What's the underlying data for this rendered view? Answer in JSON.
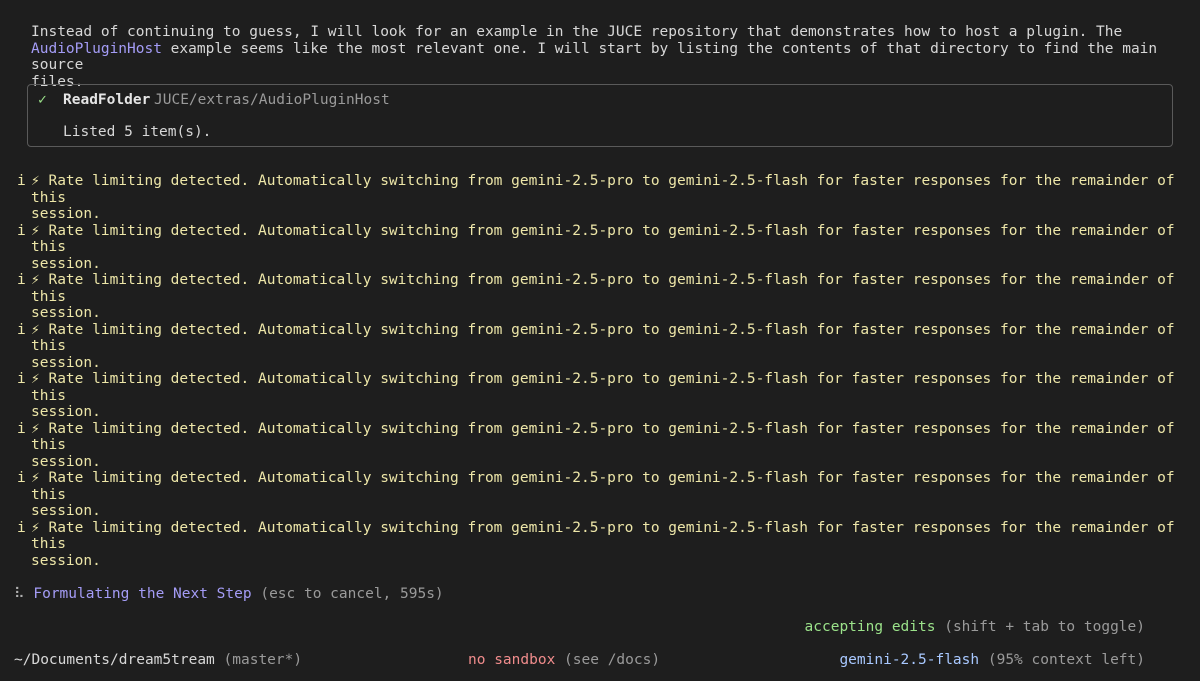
{
  "intro": {
    "line1": "Instead of continuing to guess, I will look for an example in the JUCE repository that demonstrates how to host a plugin. The",
    "link": "AudioPluginHost",
    "line2_rest": " example seems like the most relevant one. I will start by listing the contents of that directory to find the main source",
    "line3": "files."
  },
  "tool_call": {
    "status_icon": "✓",
    "name": "ReadFolder",
    "path": "JUCE/extras/AudioPluginHost",
    "result": "Listed 5 item(s)."
  },
  "notices": [
    {
      "prefix": "i",
      "icon": "⚡",
      "text": "Rate limiting detected. Automatically switching from gemini-2.5-pro to gemini-2.5-flash for faster responses for the remainder of this",
      "cont": "session."
    },
    {
      "prefix": "i",
      "icon": "⚡",
      "text": "Rate limiting detected. Automatically switching from gemini-2.5-pro to gemini-2.5-flash for faster responses for the remainder of this",
      "cont": "session."
    },
    {
      "prefix": "i",
      "icon": "⚡",
      "text": "Rate limiting detected. Automatically switching from gemini-2.5-pro to gemini-2.5-flash for faster responses for the remainder of this",
      "cont": "session."
    },
    {
      "prefix": "i",
      "icon": "⚡",
      "text": "Rate limiting detected. Automatically switching from gemini-2.5-pro to gemini-2.5-flash for faster responses for the remainder of this",
      "cont": "session."
    },
    {
      "prefix": "i",
      "icon": "⚡",
      "text": "Rate limiting detected. Automatically switching from gemini-2.5-pro to gemini-2.5-flash for faster responses for the remainder of this",
      "cont": "session."
    },
    {
      "prefix": "i",
      "icon": "⚡",
      "text": "Rate limiting detected. Automatically switching from gemini-2.5-pro to gemini-2.5-flash for faster responses for the remainder of this",
      "cont": "session."
    },
    {
      "prefix": "i",
      "icon": "⚡",
      "text": "Rate limiting detected. Automatically switching from gemini-2.5-pro to gemini-2.5-flash for faster responses for the remainder of this",
      "cont": "session."
    },
    {
      "prefix": "i",
      "icon": "⚡",
      "text": "Rate limiting detected. Automatically switching from gemini-2.5-pro to gemini-2.5-flash for faster responses for the remainder of this",
      "cont": "session."
    }
  ],
  "status": {
    "spinner": "⠧",
    "text": "Formulating the Next Step",
    "hint": " (esc to cancel, 595s)"
  },
  "mode": {
    "text": "accepting edits",
    "hint": " (shift + tab to toggle)"
  },
  "footer": {
    "path": "~/Documents/dream5tream",
    "branch": " (master*)",
    "sandbox": "no sandbox",
    "sandbox_hint": " (see /docs)",
    "model": "gemini-2.5-flash",
    "context": " (95% context left)"
  },
  "colors": {
    "background": "#1e1e1e",
    "accent_purple": "#a49cf6",
    "warning_yellow": "#ede6a8",
    "success_green": "#9be28a",
    "error_red": "#f08c8c",
    "model_blue": "#a8c8ff"
  }
}
